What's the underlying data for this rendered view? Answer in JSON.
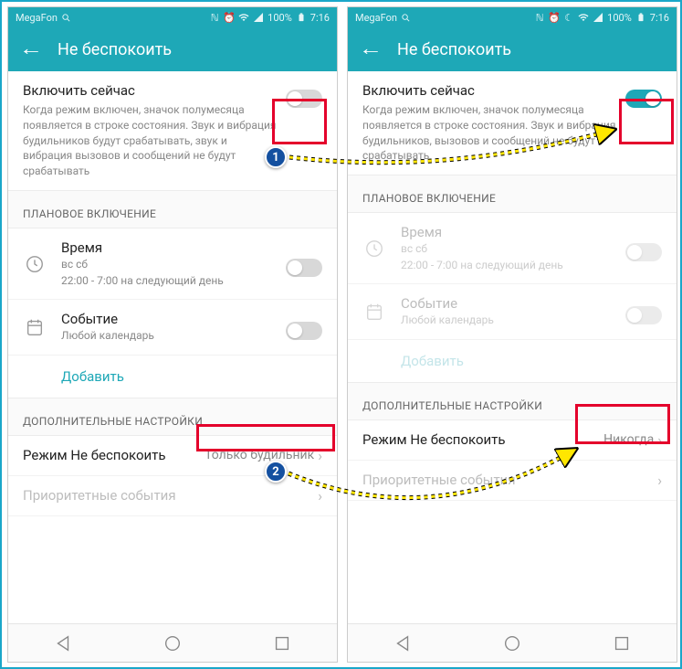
{
  "statusbar": {
    "carrier": "MegaFon",
    "battery": "100%",
    "time": "7:16"
  },
  "header": {
    "title": "Не беспокоить"
  },
  "enable": {
    "title": "Включить сейчас",
    "desc_off": "Когда режим включен, значок полумесяца появляется в строке состояния. Звук и вибрация будильников будут срабатывать, звук и вибрация вызовов и сообщений не будут срабатывать",
    "desc_on": "Когда режим включен, значок полумесяца появляется в строке состояния. Звук и вибрация будильников, вызовов и сообщений не будут срабатывать"
  },
  "scheduled": {
    "heading": "ПЛАНОВОЕ ВКЛЮЧЕНИЕ",
    "time": {
      "label": "Время",
      "days": "вс сб",
      "range": "22:00 - 7:00 на следующий день"
    },
    "event": {
      "label": "Событие",
      "sub": "Любой календарь"
    },
    "add": "Добавить"
  },
  "advanced": {
    "heading": "ДОПОЛНИТЕЛЬНЫЕ НАСТРОЙКИ",
    "dnd_mode": {
      "label": "Режим Не беспокоить",
      "value_left": "Только будильник",
      "value_right": "Никогда"
    },
    "priority": "Приоритетные события"
  },
  "annotations": {
    "b1": "1",
    "b2": "2"
  }
}
